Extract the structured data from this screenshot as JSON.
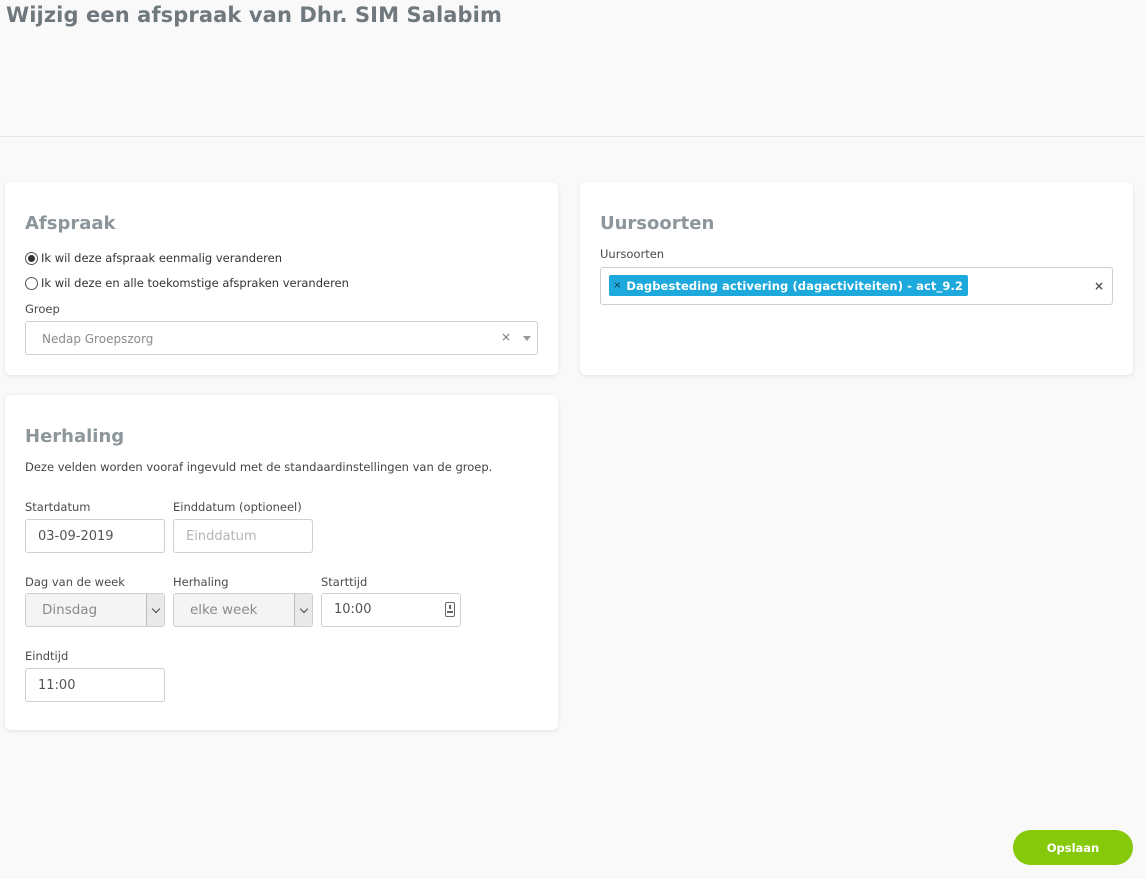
{
  "page": {
    "title": "Wijzig een afspraak van Dhr. SIM Salabim"
  },
  "afspraak": {
    "title": "Afspraak",
    "radio_options": [
      {
        "label": "Ik wil deze afspraak eenmalig veranderen",
        "checked": true
      },
      {
        "label": "Ik wil deze en alle toekomstige afspraken veranderen",
        "checked": false
      }
    ],
    "groep_label": "Groep",
    "groep_value": "Nedap Groepszorg",
    "clear_symbol": "×"
  },
  "uursoorten": {
    "title": "Uursoorten",
    "field_label": "Uursoorten",
    "tag_remove": "×",
    "selected_tag": "Dagbesteding activering (dagactiviteiten) - act_9.2",
    "clear_symbol": "×"
  },
  "herhaling": {
    "title": "Herhaling",
    "description": "Deze velden worden vooraf ingevuld met de standaardinstellingen van de groep.",
    "startdatum_label": "Startdatum",
    "startdatum_value": "03-09-2019",
    "einddatum_label": "Einddatum (optioneel)",
    "einddatum_placeholder": "Einddatum",
    "dag_label": "Dag van de week",
    "dag_value": "Dinsdag",
    "herhaling_label": "Herhaling",
    "herhaling_value": "elke week",
    "starttijd_label": "Starttijd",
    "starttijd_value": "10:00",
    "eindtijd_label": "Eindtijd",
    "eindtijd_value": "11:00"
  },
  "actions": {
    "save_label": "Opslaan"
  },
  "colors": {
    "accent_green": "#86c80a",
    "tag_blue": "#1da9dc"
  }
}
